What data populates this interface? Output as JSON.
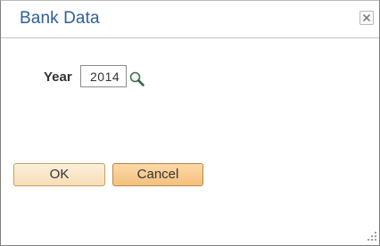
{
  "dialog": {
    "title": "Bank Data",
    "close_icon": "close-icon"
  },
  "form": {
    "year_label": "Year",
    "year_value": "2014",
    "lookup_icon": "magnifier-lookup-icon"
  },
  "buttons": {
    "ok_label": "OK",
    "cancel_label": "Cancel"
  },
  "colors": {
    "title": "#2d5f9a",
    "ok_button": "#f6ddb6",
    "cancel_button": "#f3c07d"
  }
}
